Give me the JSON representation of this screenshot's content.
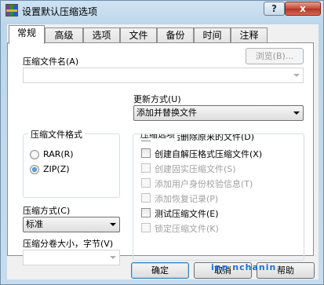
{
  "window": {
    "title": "设置默认压缩选项",
    "help_glyph": "?",
    "close_glyph": "x"
  },
  "tabs": [
    {
      "label": "常规",
      "active": true
    },
    {
      "label": "高级"
    },
    {
      "label": "选项"
    },
    {
      "label": "文件"
    },
    {
      "label": "备份"
    },
    {
      "label": "时间"
    },
    {
      "label": "注释"
    }
  ],
  "general": {
    "archive_name_label": "压缩文件名(A)",
    "archive_name_value": "",
    "browse_label": "浏览(B)...",
    "update_mode_label": "更新方式(U)",
    "update_mode_value": "添加并替换文件",
    "format_group_label": "压缩文件格式",
    "format_rar": "RAR(R)",
    "format_zip": "ZIP(Z)",
    "format_selected": "ZIP",
    "method_label": "压缩方式(C)",
    "method_value": "标准",
    "split_label": "压缩分卷大小，字节(V)",
    "split_value": "",
    "options_group_label": "压缩选项",
    "options": [
      {
        "label": "压缩后删除原来的文件(D)",
        "checked": false,
        "enabled": true,
        "clipped": true
      },
      {
        "label": "创建自解压格式压缩文件(X)",
        "checked": false,
        "enabled": true
      },
      {
        "label": "创建固实压缩文件(S)",
        "checked": false,
        "enabled": false
      },
      {
        "label": "添加用户身份校验信息(T)",
        "checked": false,
        "enabled": false
      },
      {
        "label": "添加恢复记录(P)",
        "checked": false,
        "enabled": false
      },
      {
        "label": "测试压缩文件(E)",
        "checked": false,
        "enabled": true
      },
      {
        "label": "锁定压缩文件(K)",
        "checked": false,
        "enabled": false
      }
    ]
  },
  "buttons": {
    "ok": "确定",
    "cancel": "取消",
    "help": "帮助"
  },
  "watermark": "inp nchanin"
}
